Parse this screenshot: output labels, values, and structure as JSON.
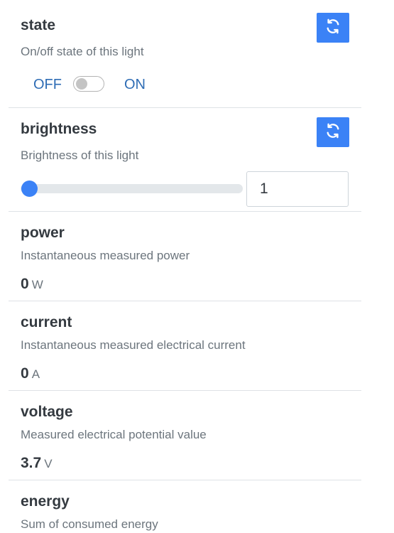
{
  "state": {
    "title": "state",
    "description": "On/off state of this light",
    "off_label": "OFF",
    "on_label": "ON",
    "toggle_on": false
  },
  "brightness": {
    "title": "brightness",
    "description": "Brightness of this light",
    "value": "1",
    "slider_fraction": 0.0
  },
  "power": {
    "title": "power",
    "description": "Instantaneous measured power",
    "value": "0",
    "unit": "W"
  },
  "current": {
    "title": "current",
    "description": "Instantaneous measured electrical current",
    "value": "0",
    "unit": "A"
  },
  "voltage": {
    "title": "voltage",
    "description": "Measured electrical potential value",
    "value": "3.7",
    "unit": "V"
  },
  "energy": {
    "title": "energy",
    "description": "Sum of consumed energy"
  },
  "colors": {
    "accent": "#3b82f6",
    "link": "#2f6db5"
  },
  "icons": {
    "refresh": "refresh-icon"
  }
}
